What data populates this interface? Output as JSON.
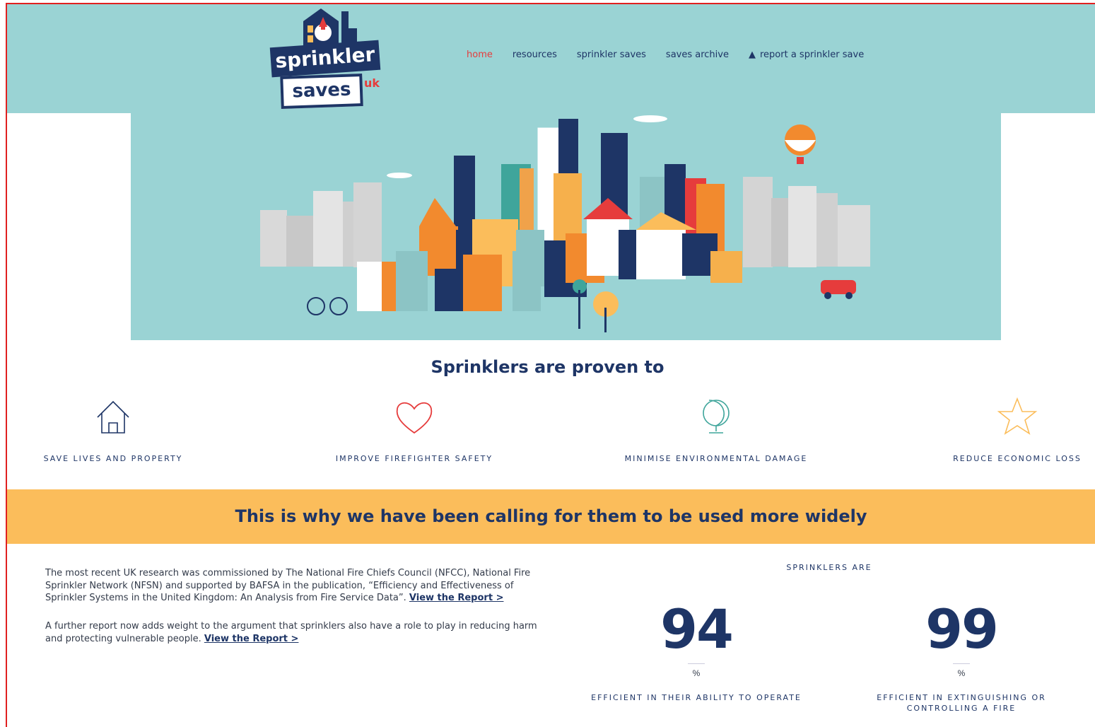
{
  "logo": {
    "line1": "sprinkler",
    "line2": "saves",
    "suffix": "uk"
  },
  "nav": {
    "items": [
      {
        "label": "home",
        "active": true
      },
      {
        "label": "resources"
      },
      {
        "label": "sprinkler saves"
      },
      {
        "label": "saves archive"
      },
      {
        "label": "report a sprinkler save",
        "icon": "warning-icon"
      }
    ]
  },
  "colors": {
    "header_bg": "#9ad3d4",
    "navy": "#1e3566",
    "accent_red": "#e63c3c",
    "banner_yellow": "#fbbd5b"
  },
  "proven": {
    "title": "Sprinklers are proven to",
    "benefits": [
      {
        "label": "SAVE LIVES AND PROPERTY",
        "icon": "house-icon"
      },
      {
        "label": "IMPROVE FIREFIGHTER SAFETY",
        "icon": "heart-icon"
      },
      {
        "label": "MINIMISE ENVIRONMENTAL DAMAGE",
        "icon": "globe-icon"
      },
      {
        "label": "REDUCE ECONOMIC LOSS",
        "icon": "star-icon"
      }
    ]
  },
  "banner": {
    "text": "This is why we have been calling for them to be used more widely"
  },
  "research": {
    "p1_text": "The most recent UK research was commissioned by The National Fire Chiefs Council (NFCC), National Fire Sprinkler Network (NFSN) and supported by BAFSA in the publication, “Efficiency and Effectiveness of Sprinkler Systems in the United Kingdom: An Analysis from Fire Service Data”. ",
    "p1_link": "View the Report >",
    "p2_text": "A further report now adds weight to the argument that sprinklers also have a role to play in reducing harm and protecting vulnerable people. ",
    "p2_link": "View the Report >"
  },
  "stats": {
    "heading": "SPRINKLERS ARE",
    "items": [
      {
        "value": "94",
        "unit": "%",
        "desc": "EFFICIENT IN THEIR ABILITY TO OPERATE"
      },
      {
        "value": "99",
        "unit": "%",
        "desc": "EFFICIENT IN EXTINGUISHING OR CONTROLLING A FIRE"
      }
    ]
  }
}
